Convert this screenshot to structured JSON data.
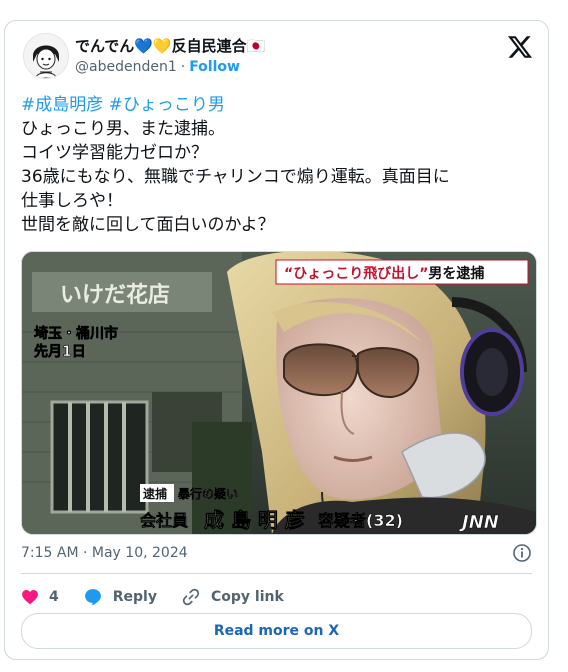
{
  "author": {
    "display_name": "でんでん💙💛反自民連合🇯🇵",
    "handle": "@abedenden1",
    "separator": "·",
    "follow_label": "Follow"
  },
  "tweet": {
    "hashtags": [
      "#成島明彦",
      "#ひょっこり男"
    ],
    "lines": [
      "ひょっこり男、また逮捕。",
      "コイツ学習能力ゼロか？",
      "36歳にもなり、無職でチャリンコで煽り運転。真面目に",
      "仕事しろや！",
      "世間を敵に回して面白いのかよ？"
    ]
  },
  "media": {
    "headline_quote": "“ひょっこり飛び出し”",
    "headline_rest": "男を逮捕",
    "shop_sign": "いけだ花店",
    "location_line1": "埼玉・桶川市",
    "location_line2": "先月1日",
    "badge": "逮捕",
    "charge": "暴行の疑い",
    "occupation": "会社員",
    "suspect_name": "成 島 明 彦",
    "suspect_suffix": "容疑者(32)",
    "network": "JNN"
  },
  "meta": {
    "timestamp": "7:15 AM · May 10, 2024"
  },
  "actions": {
    "like_count": "4",
    "reply_label": "Reply",
    "copy_label": "Copy link"
  },
  "footer": {
    "read_more_label": "Read more on X"
  },
  "colors": {
    "accent": "#1d9bf0",
    "like": "#f91880",
    "read_more": "#1d66b6",
    "border": "#cfd9de",
    "muted": "#536471"
  },
  "icons": [
    "x-logo-icon",
    "info-icon",
    "heart-icon",
    "reply-bubble-icon",
    "link-icon"
  ]
}
